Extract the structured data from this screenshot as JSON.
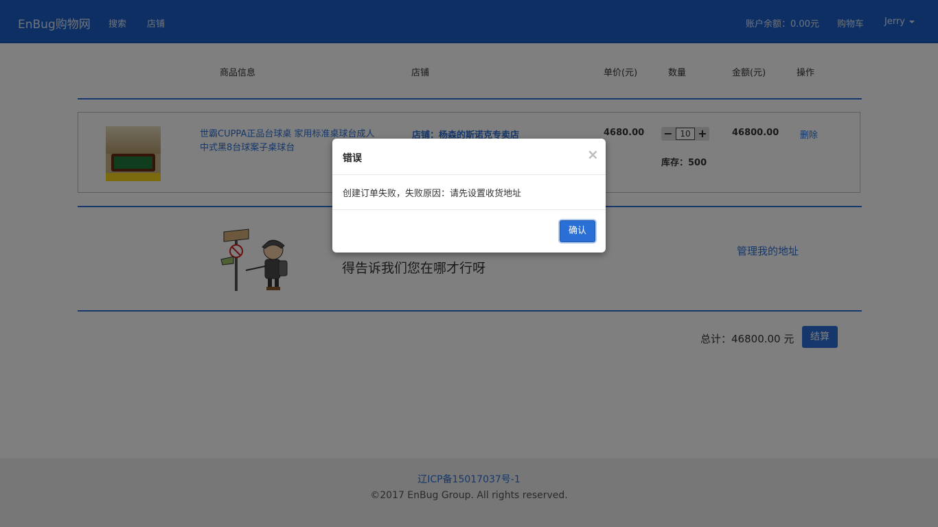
{
  "navbar": {
    "brand": "EnBug购物网",
    "search": "搜索",
    "shop": "店铺",
    "balance": "账户余额：0.00元",
    "cart": "购物车",
    "user": "Jerry"
  },
  "table_header": {
    "goods": "商品信息",
    "shop": "店铺",
    "price": "单价(元)",
    "qty": "数量",
    "amount": "金额(元)",
    "op": "操作"
  },
  "cart_item": {
    "name": "世霸CUPPA正品台球桌 家用标准桌球台成人中式黑8台球案子桌球台",
    "shop": "店铺：杨森的斯诺克专卖店",
    "price": "4680.00",
    "qty_minus": "−",
    "qty": "10",
    "qty_plus": "+",
    "stock": "库存：500",
    "amount": "46800.00",
    "delete": "删除"
  },
  "address": {
    "prompt": "得告诉我们您在哪才行呀",
    "manage": "管理我的地址"
  },
  "summary": {
    "total_label": "总计：",
    "total_value": "46800.00 元",
    "checkout": "结算"
  },
  "footer": {
    "icp": "辽ICP备15017037号-1",
    "copyright": "©2017 EnBug Group. All rights reserved."
  },
  "modal": {
    "title": "错误",
    "close": "×",
    "message": "创建订单失败，失败原因：请先设置收货地址",
    "ok": "确认"
  }
}
